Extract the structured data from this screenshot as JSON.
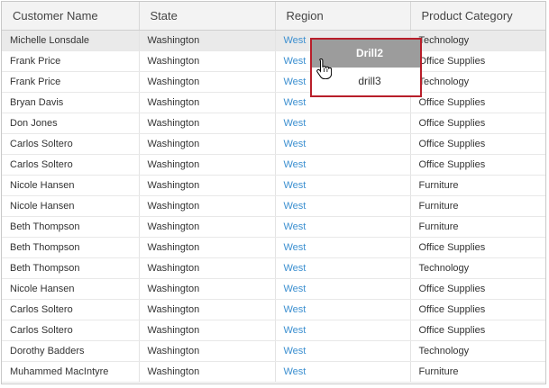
{
  "columns": [
    "Customer Name",
    "State",
    "Region",
    "Product Category"
  ],
  "rows": [
    {
      "customer": "Michelle Lonsdale",
      "state": "Washington",
      "region": "West",
      "category": "Technology"
    },
    {
      "customer": "Frank Price",
      "state": "Washington",
      "region": "West",
      "category": "Office Supplies"
    },
    {
      "customer": "Frank Price",
      "state": "Washington",
      "region": "West",
      "category": "Technology"
    },
    {
      "customer": "Bryan Davis",
      "state": "Washington",
      "region": "West",
      "category": "Office Supplies"
    },
    {
      "customer": "Don Jones",
      "state": "Washington",
      "region": "West",
      "category": "Office Supplies"
    },
    {
      "customer": "Carlos Soltero",
      "state": "Washington",
      "region": "West",
      "category": "Office Supplies"
    },
    {
      "customer": "Carlos Soltero",
      "state": "Washington",
      "region": "West",
      "category": "Office Supplies"
    },
    {
      "customer": "Nicole Hansen",
      "state": "Washington",
      "region": "West",
      "category": "Furniture"
    },
    {
      "customer": "Nicole Hansen",
      "state": "Washington",
      "region": "West",
      "category": "Furniture"
    },
    {
      "customer": "Beth Thompson",
      "state": "Washington",
      "region": "West",
      "category": "Furniture"
    },
    {
      "customer": "Beth Thompson",
      "state": "Washington",
      "region": "West",
      "category": "Office Supplies"
    },
    {
      "customer": "Beth Thompson",
      "state": "Washington",
      "region": "West",
      "category": "Technology"
    },
    {
      "customer": "Nicole Hansen",
      "state": "Washington",
      "region": "West",
      "category": "Office Supplies"
    },
    {
      "customer": "Carlos Soltero",
      "state": "Washington",
      "region": "West",
      "category": "Office Supplies"
    },
    {
      "customer": "Carlos Soltero",
      "state": "Washington",
      "region": "West",
      "category": "Office Supplies"
    },
    {
      "customer": "Dorothy Badders",
      "state": "Washington",
      "region": "West",
      "category": "Technology"
    },
    {
      "customer": "Muhammed MacIntyre",
      "state": "Washington",
      "region": "West",
      "category": "Furniture"
    }
  ],
  "context_menu": {
    "items": [
      {
        "label": "Drill2",
        "active": true
      },
      {
        "label": "drill3",
        "active": false
      }
    ],
    "border_color": "#b81e2a"
  },
  "cursor_icon": "hand-pointer-icon",
  "link_color": "#3b8fd0"
}
